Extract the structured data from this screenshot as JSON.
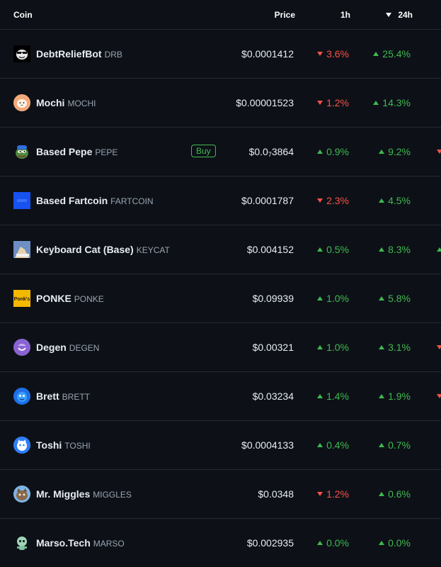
{
  "header": {
    "coin": "Coin",
    "price": "Price",
    "h1": "1h",
    "h24": "24h"
  },
  "colors": {
    "up": "#3fb950",
    "down": "#f85149",
    "background": "#0d1117"
  },
  "coins": [
    {
      "name": "DebtReliefBot",
      "symbol": "DRB",
      "price": "$0.0001412",
      "h1": "3.6%",
      "h1_dir": "down",
      "h24": "25.4%",
      "h24_dir": "up",
      "icon": "drb-logo-icon"
    },
    {
      "name": "Mochi",
      "symbol": "MOCHI",
      "price": "$0.00001523",
      "h1": "1.2%",
      "h1_dir": "down",
      "h24": "14.3%",
      "h24_dir": "up",
      "icon": "mochi-logo-icon"
    },
    {
      "name": "Based Pepe",
      "symbol": "PEPE",
      "buy": "Buy",
      "price_main": "$0.0",
      "price_sub": "7",
      "price_tail": "3864",
      "h1": "0.9%",
      "h1_dir": "up",
      "h24": "9.2%",
      "h24_dir": "up",
      "icon": "pepe-logo-icon"
    },
    {
      "name": "Based Fartcoin",
      "symbol": "FARTCOIN",
      "price": "$0.0001787",
      "h1": "2.3%",
      "h1_dir": "down",
      "h24": "4.5%",
      "h24_dir": "up",
      "icon": "fartcoin-logo-icon"
    },
    {
      "name": "Keyboard Cat (Base)",
      "symbol": "KEYCAT",
      "price": "$0.004152",
      "h1": "0.5%",
      "h1_dir": "up",
      "h24": "8.3%",
      "h24_dir": "up",
      "icon": "keycat-logo-icon"
    },
    {
      "name": "PONKE",
      "symbol": "PONKE",
      "price": "$0.09939",
      "h1": "1.0%",
      "h1_dir": "up",
      "h24": "5.8%",
      "h24_dir": "up",
      "icon": "ponke-logo-icon",
      "logo_text": "Ponk's"
    },
    {
      "name": "Degen",
      "symbol": "DEGEN",
      "price": "$0.00321",
      "h1": "1.0%",
      "h1_dir": "up",
      "h24": "3.1%",
      "h24_dir": "up",
      "icon": "degen-logo-icon"
    },
    {
      "name": "Brett",
      "symbol": "BRETT",
      "price": "$0.03234",
      "h1": "1.4%",
      "h1_dir": "up",
      "h24": "1.9%",
      "h24_dir": "up",
      "icon": "brett-logo-icon"
    },
    {
      "name": "Toshi",
      "symbol": "TOSHI",
      "price": "$0.0004133",
      "h1": "0.4%",
      "h1_dir": "up",
      "h24": "0.7%",
      "h24_dir": "up",
      "icon": "toshi-logo-icon"
    },
    {
      "name": "Mr. Miggles",
      "symbol": "MIGGLES",
      "price": "$0.0348",
      "h1": "1.2%",
      "h1_dir": "down",
      "h24": "0.6%",
      "h24_dir": "up",
      "icon": "miggles-logo-icon"
    },
    {
      "name": "Marso.Tech",
      "symbol": "MARSO",
      "price": "$0.002935",
      "h1": "0.0%",
      "h1_dir": "up",
      "h24": "0.0%",
      "h24_dir": "up",
      "icon": "marso-logo-icon"
    }
  ]
}
